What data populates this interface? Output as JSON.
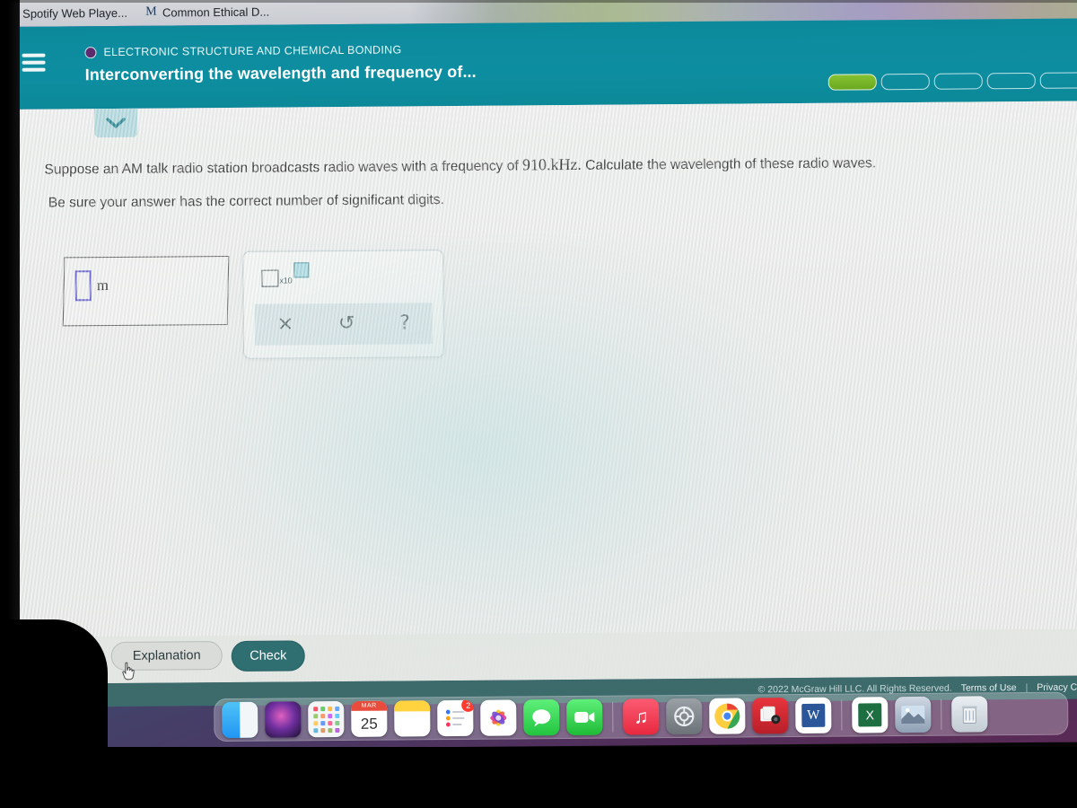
{
  "browser": {
    "tabs": [
      {
        "title": "Spotify Web Playe...",
        "favicon": "spotify-icon"
      },
      {
        "title": "Common Ethical D...",
        "favicon": "m-letter-icon"
      }
    ]
  },
  "header": {
    "menu_icon": "hamburger-icon",
    "eyebrow": "ELECTRONIC STRUCTURE AND CHEMICAL BONDING",
    "title": "Interconverting the wavelength and frequency of...",
    "accent_color": "#0d8ea0",
    "progress": {
      "segments_total": 5,
      "segments_filled": 1,
      "fill_color": "#76b328"
    }
  },
  "question": {
    "collapse_icon": "chevron-down-icon",
    "line1_before": "Suppose an AM talk radio station broadcasts radio waves with a frequency of ",
    "line1_value": "910.",
    "line1_unit": "kHz.",
    "line1_after": " Calculate the wavelength of these radio waves.",
    "line2": "Be sure your answer has the correct number of significant digits."
  },
  "answer": {
    "value": "",
    "placeholder": "",
    "unit": "m",
    "cursor_color": "#5b56c9"
  },
  "palette": {
    "scientific_notation": {
      "base_label": "x10",
      "name": "times-ten-to-power-button"
    },
    "tools": [
      {
        "glyph": "×",
        "name": "clear-button"
      },
      {
        "glyph": "↺",
        "name": "undo-button"
      },
      {
        "glyph": "?",
        "name": "help-button"
      }
    ]
  },
  "actions": {
    "explanation_label": "Explanation",
    "check_label": "Check"
  },
  "legal": {
    "copyright": "© 2022 McGraw Hill LLC. All Rights Reserved.",
    "terms": "Terms of Use",
    "separator": "|",
    "privacy": "Privacy Ce"
  },
  "dock": {
    "items": [
      {
        "name": "finder-icon",
        "label": "Finder",
        "glyph": ""
      },
      {
        "name": "siri-icon",
        "label": "Siri",
        "glyph": ""
      },
      {
        "name": "launchpad-icon",
        "label": "Launchpad",
        "glyph": ""
      },
      {
        "name": "calendar-icon",
        "label": "Calendar",
        "month": "MAR",
        "day": "25"
      },
      {
        "name": "notes-icon",
        "label": "Notes",
        "glyph": ""
      },
      {
        "name": "reminders-icon",
        "label": "Reminders",
        "badge": "2"
      },
      {
        "name": "photos-icon",
        "label": "Photos",
        "glyph": "✿"
      },
      {
        "name": "messages-icon",
        "label": "Messages",
        "glyph": "💬"
      },
      {
        "name": "facetime-icon",
        "label": "FaceTime",
        "glyph": "▶"
      },
      {
        "name": "music-icon",
        "label": "Music",
        "glyph": "♪"
      },
      {
        "name": "settings-icon",
        "label": "System Settings",
        "glyph": "⚙"
      },
      {
        "name": "chrome-icon",
        "label": "Google Chrome",
        "glyph": ""
      },
      {
        "name": "photobooth-icon",
        "label": "Photo Booth",
        "glyph": ""
      },
      {
        "name": "word-icon",
        "label": "Microsoft Word",
        "glyph": "W"
      },
      {
        "name": "excel-icon",
        "label": "Microsoft Excel",
        "glyph": "X"
      },
      {
        "name": "preview-icon",
        "label": "Preview",
        "glyph": ""
      },
      {
        "name": "trash-icon",
        "label": "Trash",
        "glyph": ""
      }
    ]
  }
}
